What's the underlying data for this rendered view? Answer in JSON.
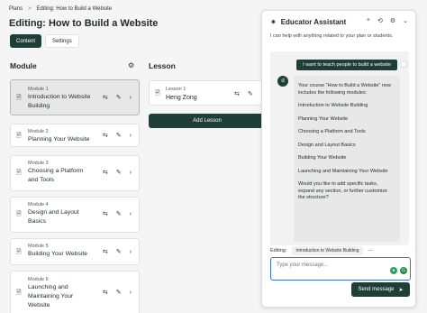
{
  "breadcrumb": {
    "root": "Plans",
    "separator": ">",
    "current": "Editing: How to Build a Website"
  },
  "page_title": "Editing: How to Build a Website",
  "tabs": {
    "content": "Content",
    "settings": "Settings"
  },
  "module_heading": "Module",
  "lesson_heading": "Lesson",
  "modules": [
    {
      "number": "Module 1",
      "title": "Introduction to Website Building",
      "selected": true
    },
    {
      "number": "Module 2",
      "title": "Planning Your Website"
    },
    {
      "number": "Module 3",
      "title": "Choosing a Platform and Tools"
    },
    {
      "number": "Module 4",
      "title": "Design and Layout Basics"
    },
    {
      "number": "Module 5",
      "title": "Building Your Website"
    },
    {
      "number": "Module 6",
      "title": "Launching and Maintaining Your Website"
    }
  ],
  "lesson": {
    "number": "Lesson 1",
    "title": "Heng Zong"
  },
  "add_lesson_label": "Add Lesson",
  "assistant": {
    "title": "Educator Assistant",
    "subtitle": "I can help with anything related to your plan or students.",
    "user_message": "I want to teach people to build a website",
    "ai_avatar": "d",
    "ai_message": [
      "Your course \"How to Build a Website\" now includes the following modules:",
      "Introduction to Website Building",
      "Planning Your Website",
      "Choosing a Platform and Tools",
      "Design and Layout Basics",
      "Building Your Website",
      "Launching and Maintaining Your Website",
      "Would you like to add specific tasks, expand any section, or further customize the structure?"
    ],
    "editing_label": "Editing:",
    "editing_value": "Introduction to Website Building",
    "input_placeholder": "Type your message...",
    "send_label": "Send message"
  },
  "colors": {
    "primary": "#1e3f35",
    "input_focus": "#3b6fd8",
    "selected_card": "#e6e7e6"
  }
}
